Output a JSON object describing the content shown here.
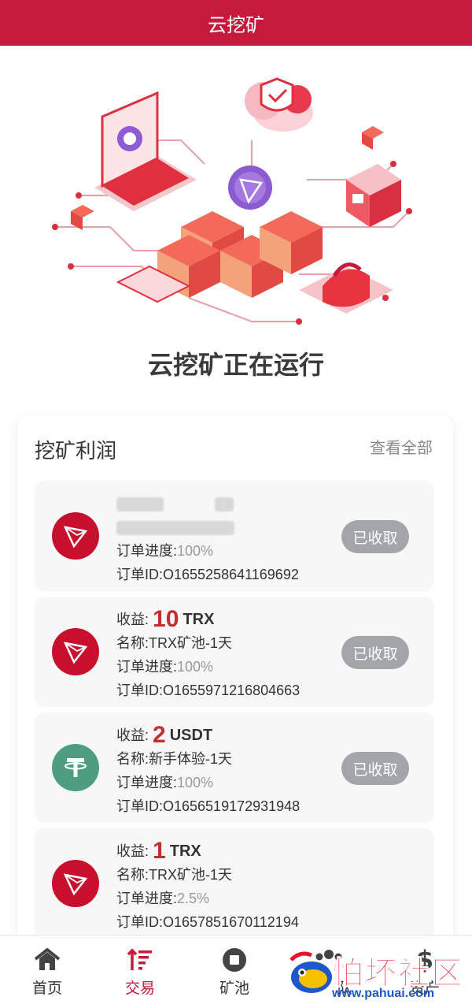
{
  "header": {
    "title": "云挖矿"
  },
  "hero": {
    "title": "云挖矿正在运行"
  },
  "profits": {
    "title": "挖矿利润",
    "view_all": "查看全部",
    "items": [
      {
        "coin": "trx-icon",
        "profit_label": "",
        "amount": "",
        "unit": "",
        "name": "",
        "progress_label": "订单进度:",
        "progress": "100%",
        "order_id": "订单ID:O1655258641169692",
        "button": "已收取",
        "obscured": true
      },
      {
        "coin": "trx-icon",
        "profit_label": "收益:",
        "amount": "10",
        "unit": "TRX",
        "name": "名称:TRX矿池-1天",
        "progress_label": "订单进度:",
        "progress": "100%",
        "order_id": "订单ID:O1655971216804663",
        "button": "已收取"
      },
      {
        "coin": "usdt-icon",
        "profit_label": "收益:",
        "amount": "2",
        "unit": "USDT",
        "name": "名称:新手体验-1天",
        "progress_label": "订单进度:",
        "progress": "100%",
        "order_id": "订单ID:O1656519172931948",
        "button": "已收取"
      },
      {
        "coin": "trx-icon",
        "profit_label": "收益:",
        "amount": "1",
        "unit": "TRX",
        "name": "名称:TRX矿池-1天",
        "progress_label": "订单进度:",
        "progress": "2.5%",
        "order_id": "订单ID:O1657851670112194",
        "button": ""
      }
    ]
  },
  "tabbar": {
    "items": [
      {
        "label": "首页",
        "icon": "home-icon"
      },
      {
        "label": "交易",
        "icon": "sort-icon",
        "active": true
      },
      {
        "label": "矿池",
        "icon": "stop-icon"
      },
      {
        "label": "队",
        "icon": "team-icon"
      },
      {
        "label": "资产",
        "icon": "dollar-icon"
      }
    ]
  },
  "watermark": {
    "text": "怕坏社区",
    "url": "www.pahuai.com"
  },
  "colors": {
    "brand": "#c41a3c",
    "amount": "#c03030",
    "button_gray": "#a2a5aa",
    "trx": "#c8102e",
    "usdt": "#4d9e7f"
  }
}
